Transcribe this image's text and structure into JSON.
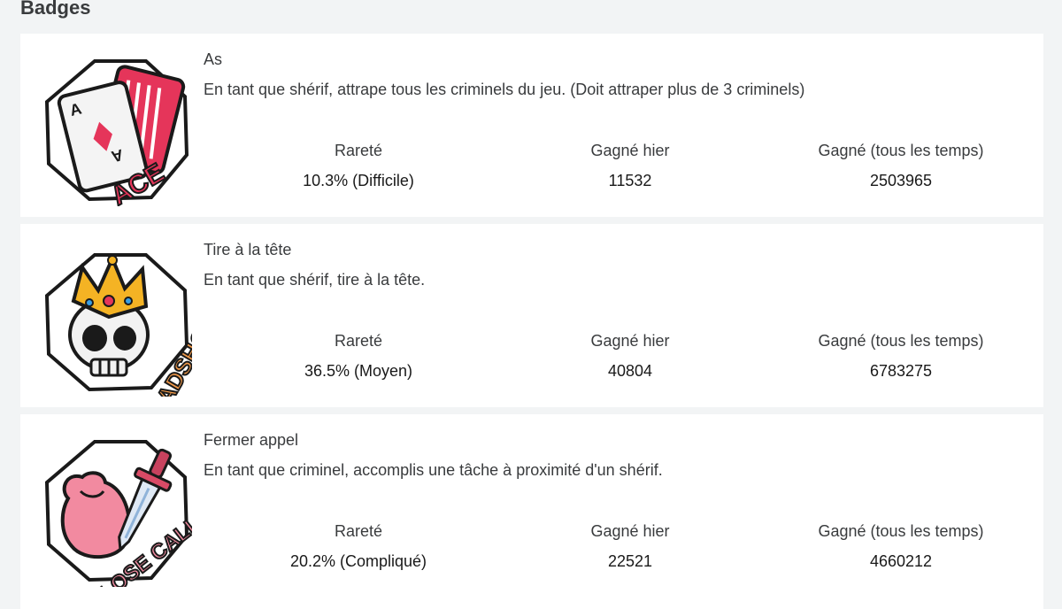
{
  "section": {
    "title": "Badges"
  },
  "badges": [
    {
      "name": "As",
      "description": "En tant que shérif, attrape tous les criminels du jeu. (Doit attraper plus de 3 criminels)",
      "image_text": "ACE",
      "icon": "ace-card-badge-icon",
      "stats": {
        "rarity_label": "Rareté",
        "rarity_value": "10.3% (Difficile)",
        "yesterday_label": "Gagné hier",
        "yesterday_value": "11532",
        "alltime_label": "Gagné (tous les temps)",
        "alltime_value": "2503965"
      }
    },
    {
      "name": "Tire à la tête",
      "description": "En tant que shérif, tire à la tête.",
      "image_text": "HEADSHOT",
      "icon": "crowned-skull-badge-icon",
      "stats": {
        "rarity_label": "Rareté",
        "rarity_value": "36.5% (Moyen)",
        "yesterday_label": "Gagné hier",
        "yesterday_value": "40804",
        "alltime_label": "Gagné (tous les temps)",
        "alltime_value": "6783275"
      }
    },
    {
      "name": "Fermer appel",
      "description": "En tant que criminel, accomplis une tâche à proximité d'un shérif.",
      "image_text": "CLOSE CALL",
      "icon": "knife-and-bag-badge-icon",
      "stats": {
        "rarity_label": "Rareté",
        "rarity_value": "20.2% (Compliqué)",
        "yesterday_label": "Gagné hier",
        "yesterday_value": "22521",
        "alltime_label": "Gagné (tous les temps)",
        "alltime_value": "4660212"
      }
    }
  ],
  "colors": {
    "page_bg": "#f2f4f5",
    "card_bg": "#ffffff",
    "text": "#393b3d",
    "badge_pink": "#e5355a",
    "badge_outline": "#1a1a1a"
  }
}
